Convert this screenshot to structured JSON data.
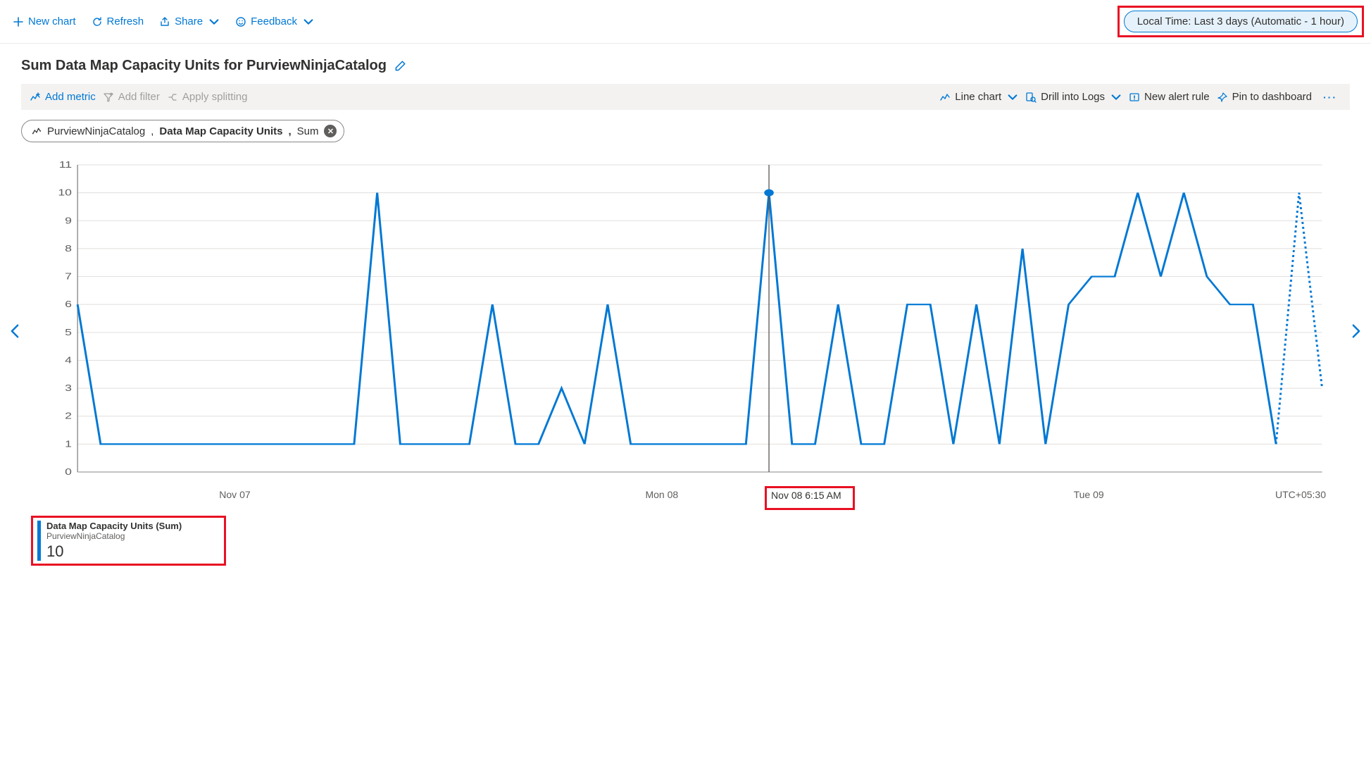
{
  "toolbar": {
    "new_chart": "New chart",
    "refresh": "Refresh",
    "share": "Share",
    "feedback": "Feedback",
    "time_range": "Local Time: Last 3 days (Automatic - 1 hour)"
  },
  "chart_title": "Sum Data Map Capacity Units for PurviewNinjaCatalog",
  "inner_toolbar": {
    "add_metric": "Add metric",
    "add_filter": "Add filter",
    "apply_splitting": "Apply splitting",
    "line_chart": "Line chart",
    "drill_logs": "Drill into Logs",
    "new_alert": "New alert rule",
    "pin_dashboard": "Pin to dashboard"
  },
  "metric_chip": {
    "resource": "PurviewNinjaCatalog",
    "metric": "Data Map Capacity Units",
    "aggregation": "Sum"
  },
  "x_axis": {
    "ticks": [
      "Nov 07",
      "Mon 08",
      "Tue 09"
    ],
    "timezone": "UTC+05:30"
  },
  "hover": {
    "label": "Nov 08 6:15 AM",
    "index": 30,
    "value": 10
  },
  "legend": {
    "title": "Data Map Capacity Units (Sum)",
    "subtitle": "PurviewNinjaCatalog",
    "value": "10"
  },
  "chart_data": {
    "type": "line",
    "title": "Sum Data Map Capacity Units for PurviewNinjaCatalog",
    "ylabel": "",
    "xlabel": "",
    "ylim": [
      0,
      11
    ],
    "y_ticks": [
      0,
      1,
      2,
      3,
      4,
      5,
      6,
      7,
      8,
      9,
      10,
      11
    ],
    "x_tick_labels": [
      "Nov 07",
      "Mon 08",
      "Tue 09"
    ],
    "x_tick_positions": [
      8,
      26,
      44
    ],
    "timezone": "UTC+05:30",
    "hover_point": {
      "index": 30,
      "value": 10,
      "label": "Nov 08 6:15 AM"
    },
    "series": [
      {
        "name": "Data Map Capacity Units (Sum) — PurviewNinjaCatalog",
        "color": "#0078d4",
        "values": [
          6,
          1,
          1,
          1,
          1,
          1,
          1,
          1,
          1,
          1,
          1,
          1,
          1,
          10,
          1,
          1,
          1,
          1,
          6,
          1,
          1,
          3,
          1,
          6,
          1,
          1,
          1,
          1,
          1,
          1,
          10,
          1,
          1,
          6,
          1,
          1,
          6,
          6,
          1,
          6,
          1,
          8,
          1,
          6,
          7,
          7,
          10,
          7,
          10,
          7,
          6,
          6,
          1,
          10,
          3
        ],
        "trailing_dotted_count": 2
      }
    ]
  }
}
